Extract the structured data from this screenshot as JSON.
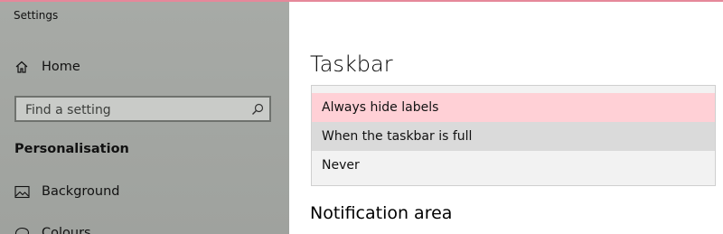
{
  "window": {
    "title": "Settings",
    "accent_color": "#e6889a"
  },
  "sidebar": {
    "home": {
      "label": "Home",
      "icon": "home-icon"
    },
    "search": {
      "placeholder": "Find a setting",
      "value": "",
      "icon": "search-icon"
    },
    "section_title": "Personalisation",
    "items": [
      {
        "label": "Background",
        "icon": "picture-icon"
      },
      {
        "label": "Colours",
        "icon": "palette-icon"
      }
    ]
  },
  "main": {
    "page_title": "Taskbar",
    "dropdown": {
      "options": [
        {
          "label": "Always hide labels",
          "state": "selected"
        },
        {
          "label": "When the taskbar is full",
          "state": "hover"
        },
        {
          "label": "Never",
          "state": "normal"
        }
      ],
      "selected_color": "#ffd0d6"
    },
    "subheading": "Notification area"
  }
}
